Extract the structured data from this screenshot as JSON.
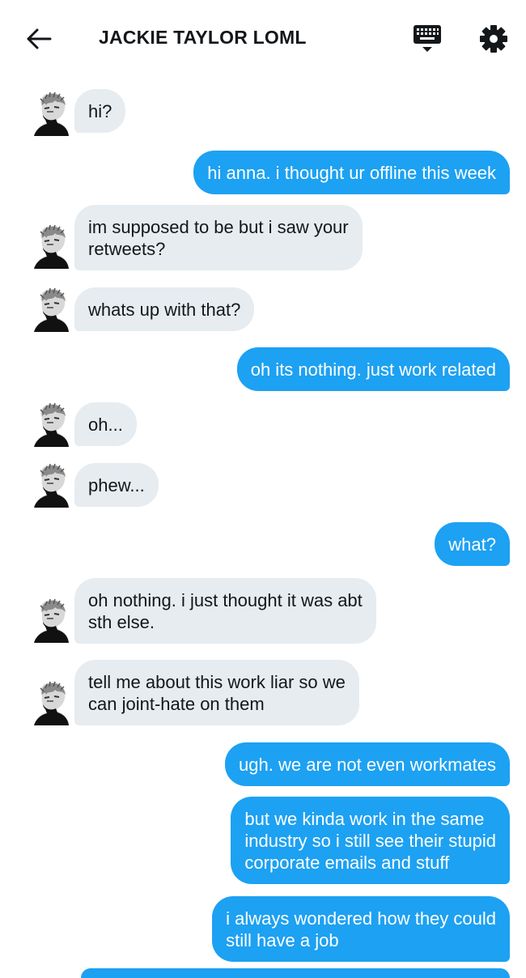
{
  "header": {
    "title": "JACKIE TAYLOR LOML",
    "back_icon": "arrow-left-icon",
    "keyboard_icon": "keyboard-icon",
    "settings_icon": "gear-icon"
  },
  "colors": {
    "incoming_bubble": "#e6ecf0",
    "outgoing_bubble": "#1da1f2",
    "text_dark": "#14171a"
  },
  "messages": [
    {
      "dir": "in",
      "text": "hi?"
    },
    {
      "dir": "out",
      "text": "hi anna. i thought ur offline this week"
    },
    {
      "dir": "in",
      "text": "im supposed to be but i saw your\nretweets?"
    },
    {
      "dir": "in",
      "text": "whats up with that?"
    },
    {
      "dir": "out",
      "text": "oh its nothing. just work related"
    },
    {
      "dir": "in",
      "text": "oh..."
    },
    {
      "dir": "in",
      "text": "phew..."
    },
    {
      "dir": "out",
      "text": "what?"
    },
    {
      "dir": "in",
      "text": "oh nothing. i just thought it was abt\nsth else."
    },
    {
      "dir": "in",
      "text": "tell me about this work liar so we\ncan joint-hate on them"
    },
    {
      "dir": "out",
      "text": "ugh. we are not even workmates"
    },
    {
      "dir": "out",
      "text": "but we kinda work in the same\nindustry so i still see their stupid\ncorporate emails and stuff"
    },
    {
      "dir": "out",
      "text": "i always wondered how they could\nstill have a job"
    }
  ]
}
